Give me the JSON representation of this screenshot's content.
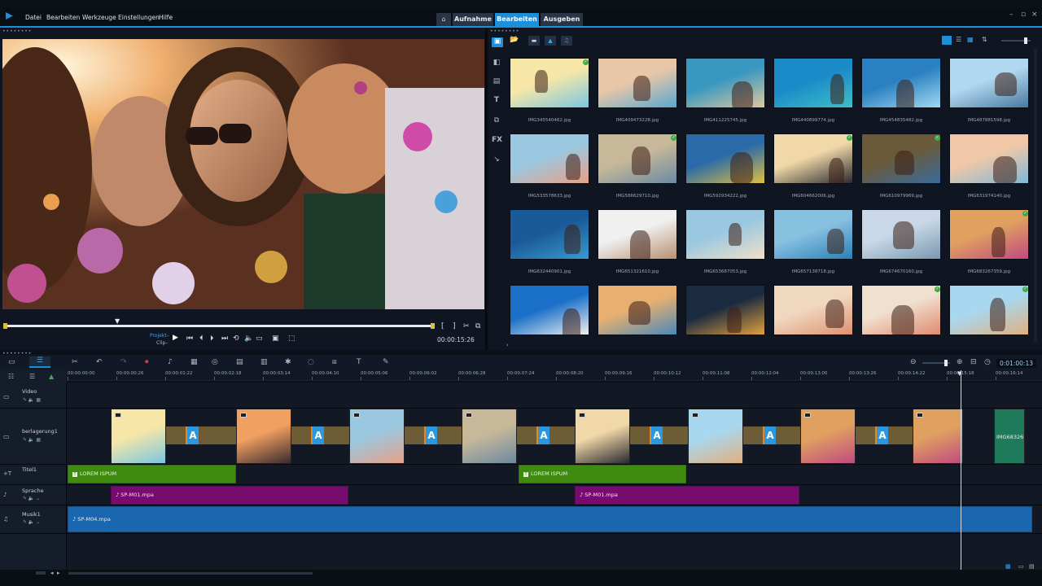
{
  "menu": [
    "Datei",
    "Bearbeiten",
    "Werkzeuge",
    "Einstellungen",
    "Hilfe"
  ],
  "workspace_tabs": [
    {
      "label": "Aufnahme",
      "active": false
    },
    {
      "label": "Bearbeiten",
      "active": true
    },
    {
      "label": "Ausgeben",
      "active": false
    }
  ],
  "player": {
    "projekt_label": "Projekt–",
    "clip_label": "Clip–",
    "timecode": "00:00:15:26"
  },
  "library": {
    "thumbs": [
      {
        "name": "IMG345540462.jpg",
        "checked": true
      },
      {
        "name": "IMG409473228.jpg",
        "checked": false
      },
      {
        "name": "IMG411225745.jpg",
        "checked": false
      },
      {
        "name": "IMG440899774.jpg",
        "checked": false
      },
      {
        "name": "IMG454835482.jpg",
        "checked": false
      },
      {
        "name": "IMG487881598.jpg",
        "checked": false
      },
      {
        "name": "IMG533578633.jpg",
        "checked": false
      },
      {
        "name": "IMG586629710.jpg",
        "checked": true
      },
      {
        "name": "IMG592934222.jpg",
        "checked": false
      },
      {
        "name": "IMG604662006.jpg",
        "checked": true
      },
      {
        "name": "IMG610979969.jpg",
        "checked": true
      },
      {
        "name": "IMG631974140.jpg",
        "checked": false
      },
      {
        "name": "IMG632440901.jpg",
        "checked": false
      },
      {
        "name": "IMG651321610.jpg",
        "checked": false
      },
      {
        "name": "IMG653687053.jpg",
        "checked": false
      },
      {
        "name": "IMG657138718.jpg",
        "checked": false
      },
      {
        "name": "IMG674670160.jpg",
        "checked": false
      },
      {
        "name": "IMG683267359.jpg",
        "checked": true
      },
      {
        "name": "",
        "checked": false
      },
      {
        "name": "",
        "checked": false
      },
      {
        "name": "",
        "checked": false
      },
      {
        "name": "",
        "checked": false
      },
      {
        "name": "",
        "checked": true
      },
      {
        "name": "",
        "checked": true
      }
    ]
  },
  "timeline": {
    "zoom_timecode": "0:01:00:13",
    "ruler": [
      "00:00:00:00",
      "00:00:00:26",
      "00:00:01:22",
      "00:00:02:18",
      "00:00:03:14",
      "00:00:04:10",
      "00:00:05:06",
      "00:00:06:02",
      "00:00:06:28",
      "00:00:07:24",
      "00:00:08:20",
      "00:00:09:16",
      "00:00:10:12",
      "00:00:11:08",
      "00:00:12:04",
      "00:00:13:00",
      "00:00:13:26",
      "00:00:14:22",
      "00:00:15:18",
      "00:00:16:14"
    ],
    "tracks": {
      "video": "Video",
      "overlay": "berlagerung1",
      "title": "Titel1",
      "voice": "Sprache",
      "music": "Musik1"
    },
    "overlay_last_clip": "IMG683267...",
    "title_clips": [
      "LOREM ISPUM",
      "LOREM ISPUM"
    ],
    "voice_clips": [
      "SP-M01.mpa",
      "SP-M01.mpa"
    ],
    "music_clip": "SP-M04.mpa",
    "transition_glyph": "A"
  },
  "colors": {
    "accent": "#1c8fd8",
    "title_clip": "#3f8b12",
    "voice_clip": "#780c6e",
    "music_clip": "#1a67b0",
    "transition": "#2a98e0"
  }
}
